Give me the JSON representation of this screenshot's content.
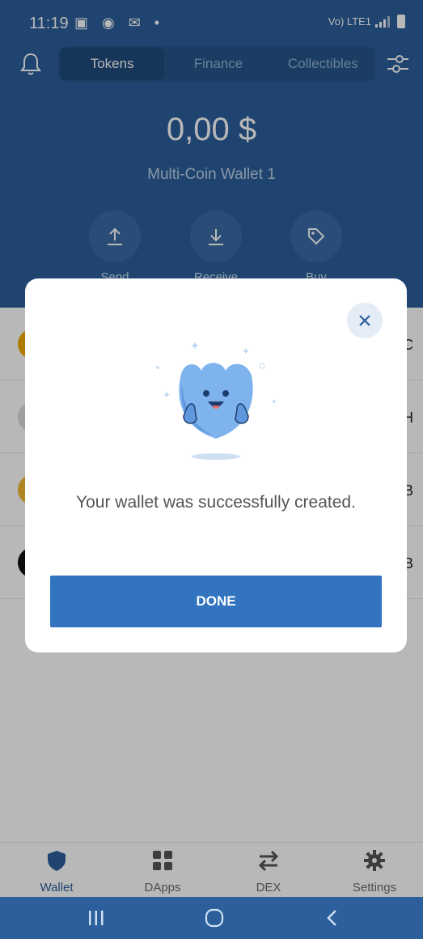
{
  "status_bar": {
    "time": "11:19",
    "left_icons": "▣ ◉ ✉ •",
    "network": "Vo) LTE1"
  },
  "header": {
    "tabs": [
      {
        "label": "Tokens"
      },
      {
        "label": "Finance"
      },
      {
        "label": "Collectibles"
      }
    ],
    "balance": "0,00 $",
    "wallet_name": "Multi-Coin Wallet 1",
    "actions": [
      {
        "label": "Send"
      },
      {
        "label": "Receive"
      },
      {
        "label": "Buy"
      }
    ]
  },
  "token_tickers": [
    "C",
    "H",
    "B",
    "B"
  ],
  "modal": {
    "message": "Your wallet was successfully created.",
    "done_label": "DONE"
  },
  "bottom_nav": [
    {
      "label": "Wallet",
      "icon": "shield-icon"
    },
    {
      "label": "DApps",
      "icon": "grid-icon"
    },
    {
      "label": "DEX",
      "icon": "swap-icon"
    },
    {
      "label": "Settings",
      "icon": "gear-icon"
    }
  ],
  "colors": {
    "primary": "#2c5f9b",
    "button": "#3274c0"
  }
}
